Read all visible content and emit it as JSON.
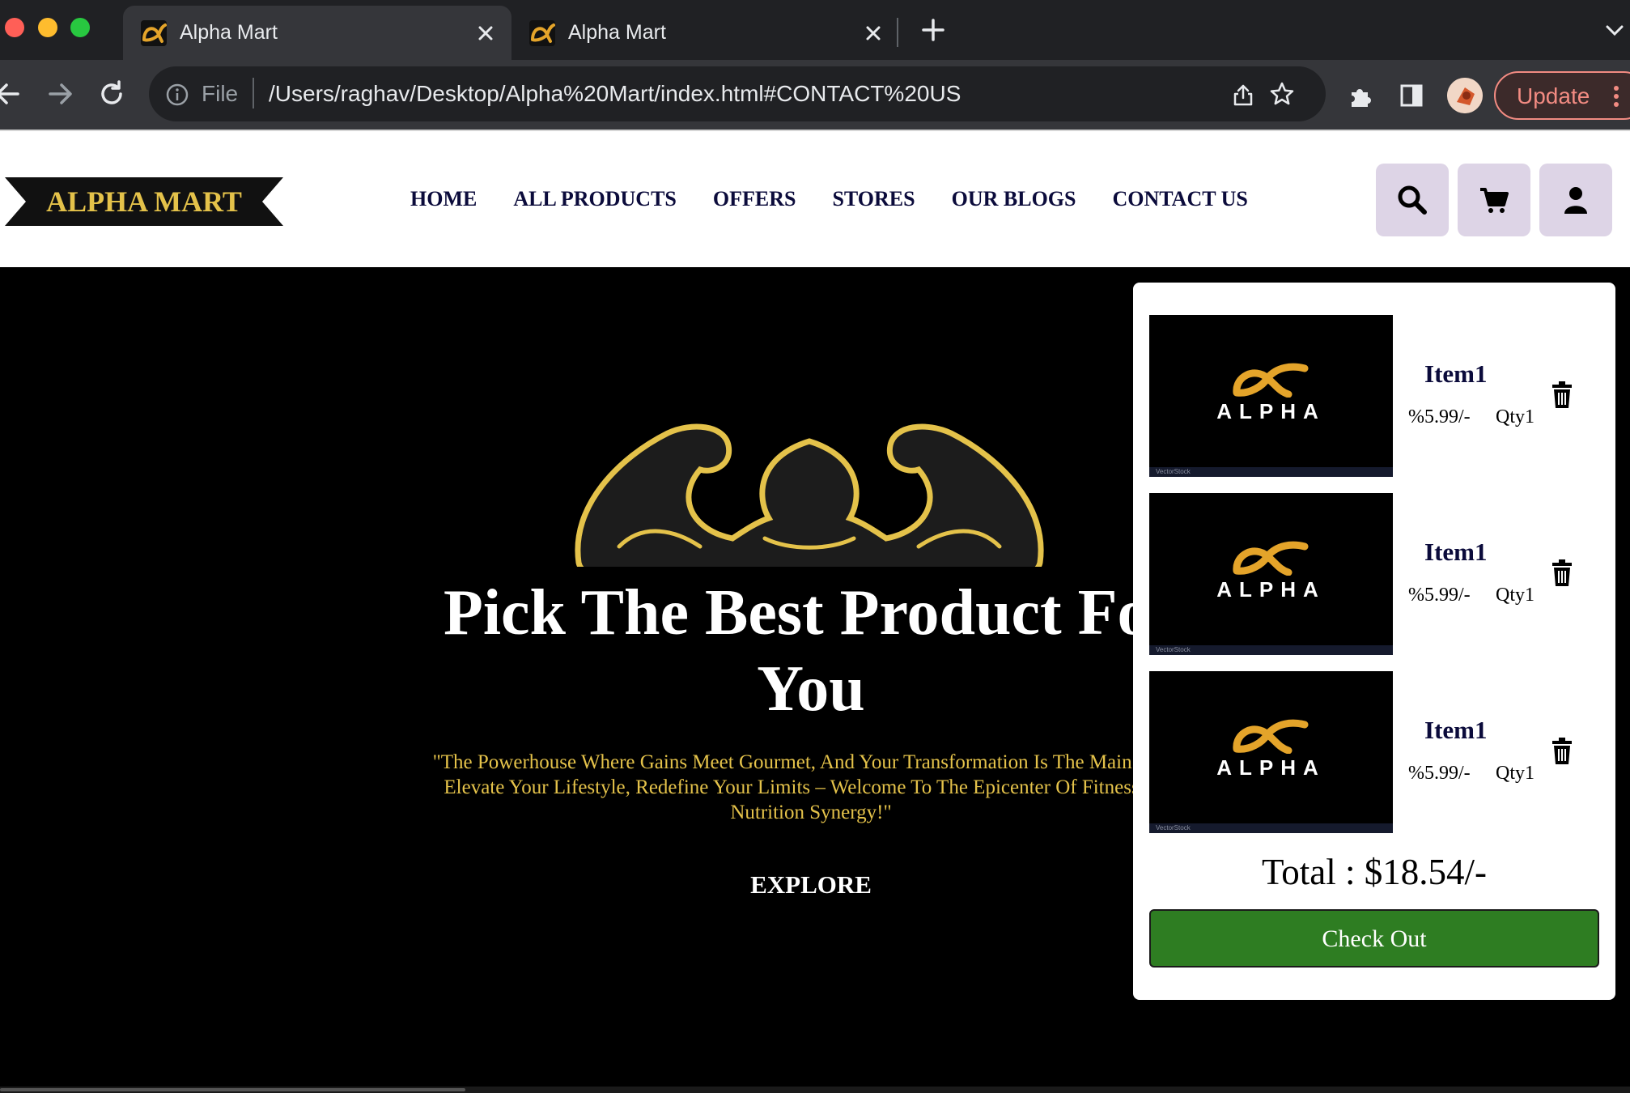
{
  "browser": {
    "tabs": [
      {
        "title": "Alpha Mart",
        "active": true
      },
      {
        "title": "Alpha Mart",
        "active": false
      }
    ],
    "omnibox": {
      "scheme_label": "File",
      "url": "/Users/raghav/Desktop/Alpha%20Mart/index.html#CONTACT%20US"
    },
    "update_label": "Update"
  },
  "header": {
    "logo_text": "ALPHA MART",
    "nav": [
      "HOME",
      "ALL PRODUCTS",
      "OFFERS",
      "STORES",
      "OUR BLOGS",
      "CONTACT US"
    ],
    "icons": [
      "search-icon",
      "cart-icon",
      "user-icon"
    ]
  },
  "hero": {
    "title": "Pick The Best Product For You",
    "quote": "\"The Powerhouse Where Gains Meet Gourmet, And Your Transformation Is The Main Event. Elevate Your Lifestyle, Redefine Your Limits – Welcome To The Epicenter Of Fitness And Nutrition Synergy!\"",
    "cta": "EXPLORE"
  },
  "cart": {
    "items": [
      {
        "name": "Item1",
        "price": "%5.99/-",
        "qty": "Qty1",
        "image_text": "ALPHA",
        "image_credit": "VectorStock"
      },
      {
        "name": "Item1",
        "price": "%5.99/-",
        "qty": "Qty1",
        "image_text": "ALPHA",
        "image_credit": "VectorStock"
      },
      {
        "name": "Item1",
        "price": "%5.99/-",
        "qty": "Qty1",
        "image_text": "ALPHA",
        "image_credit": "VectorStock"
      }
    ],
    "total": "Total : $18.54/-",
    "checkout_label": "Check Out"
  },
  "colors": {
    "brand_gold": "#e4c24a",
    "nav_text": "#0b0b3b",
    "header_button_bg": "#ddd4e6",
    "checkout_green": "#2e7d22"
  }
}
